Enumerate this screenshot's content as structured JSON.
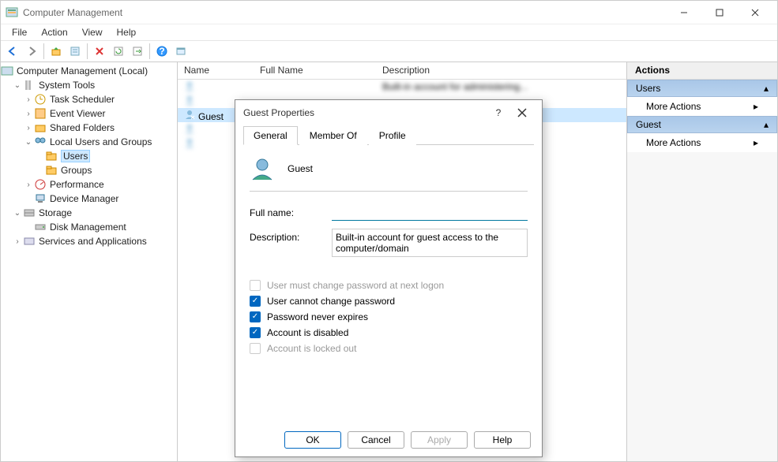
{
  "window": {
    "title": "Computer Management"
  },
  "menu": {
    "file": "File",
    "action": "Action",
    "view": "View",
    "help": "Help"
  },
  "tree": {
    "root": "Computer Management (Local)",
    "system_tools": "System Tools",
    "task_scheduler": "Task Scheduler",
    "event_viewer": "Event Viewer",
    "shared_folders": "Shared Folders",
    "local_users": "Local Users and Groups",
    "users": "Users",
    "groups": "Groups",
    "performance": "Performance",
    "device_manager": "Device Manager",
    "storage": "Storage",
    "disk_management": "Disk Management",
    "services_apps": "Services and Applications"
  },
  "list": {
    "columns": {
      "name": "Name",
      "fullname": "Full Name",
      "description": "Description"
    },
    "rows": [
      {
        "name": "",
        "fullname": "",
        "description": "Built-in account for administering..."
      },
      {
        "name": "",
        "fullname": "",
        "description": ""
      },
      {
        "name": "Guest",
        "fullname": "",
        "description": ""
      },
      {
        "name": "",
        "fullname": "",
        "description": ""
      },
      {
        "name": "",
        "fullname": "",
        "description": ""
      }
    ]
  },
  "actions": {
    "header": "Actions",
    "users_section": "Users",
    "more_actions": "More Actions",
    "guest_section": "Guest"
  },
  "dialog": {
    "title": "Guest Properties",
    "tabs": {
      "general": "General",
      "member_of": "Member Of",
      "profile": "Profile"
    },
    "username": "Guest",
    "fullname_label": "Full name:",
    "fullname_value": "",
    "description_label": "Description:",
    "description_value": "Built-in account for guest access to the computer/domain",
    "checks": {
      "must_change": "User must change password at next logon",
      "cannot_change": "User cannot change password",
      "never_expires": "Password never expires",
      "disabled": "Account is disabled",
      "locked_out": "Account is locked out"
    },
    "buttons": {
      "ok": "OK",
      "cancel": "Cancel",
      "apply": "Apply",
      "help": "Help"
    }
  }
}
